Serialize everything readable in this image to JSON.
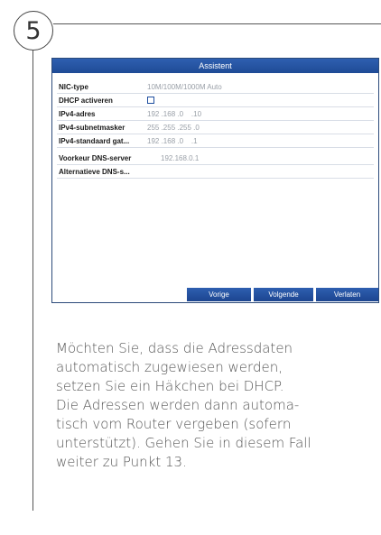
{
  "step": {
    "number": "5"
  },
  "dialog": {
    "title": "Assistent",
    "fields": [
      {
        "label": "NIC-type",
        "value": "10M/100M/1000M Auto"
      },
      {
        "label": "DHCP activeren",
        "value": ""
      },
      {
        "label": "IPv4-adres",
        "value": "192 .168 .0    .10"
      },
      {
        "label": "IPv4-subnetmasker",
        "value": "255 .255 .255 .0"
      },
      {
        "label": "IPv4-standaard gat...",
        "value": "192 .168 .0    .1"
      },
      {
        "label": "Voorkeur DNS-server",
        "value": "192.168.0.1"
      },
      {
        "label": "Alternatieve DNS-s...",
        "value": ""
      }
    ],
    "buttons": {
      "previous": "Vorige",
      "next": "Volgende",
      "exit": "Verlaten"
    }
  },
  "instructions": {
    "lines": [
      "Möchten Sie, dass die Adressdaten",
      "automatisch zugewiesen werden,",
      "setzen Sie ein Häkchen bei DHCP.",
      "Die Adressen werden dann automa-",
      "tisch vom Router vergeben (sofern",
      "unterstützt). Gehen Sie in diesem Fall",
      "weiter zu Punkt 13."
    ]
  }
}
